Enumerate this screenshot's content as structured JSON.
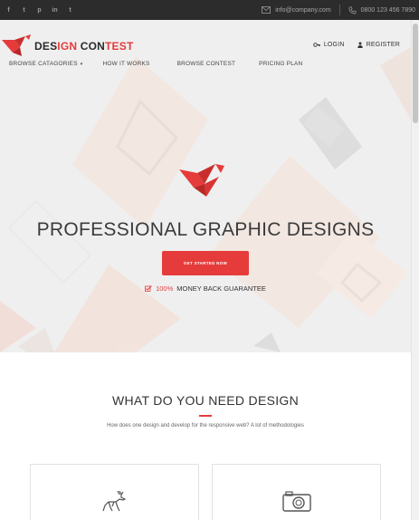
{
  "topbar": {
    "social": [
      "f",
      "t",
      "p",
      "in",
      "t"
    ],
    "email": "info@company.com",
    "phone": "0800 123 456 7890"
  },
  "header": {
    "logo": {
      "part1": "DES",
      "part2": "IGN",
      "part3": " CON",
      "part4": "TEST"
    },
    "account": {
      "login": "LOGIN",
      "register": "REGISTER"
    },
    "nav": [
      "BROWSE CATAGORIES",
      "HOW IT WORKS",
      "BROWSE CONTEST",
      "PRICING PLAN"
    ]
  },
  "hero": {
    "title": "PROFESSIONAL GRAPHIC DESIGNS",
    "cta": "GET STARTED NOW",
    "guarantee_pct": "100%",
    "guarantee_text": "MONEY BACK GUARANTEE"
  },
  "section": {
    "title": "WHAT DO YOU NEED DESIGN",
    "subtitle": "How does one design and develop for the responsive web? A lot of methodologies"
  },
  "colors": {
    "accent": "#e63b3b",
    "topbar": "#2c2c2c",
    "hero_bg": "#efefef"
  },
  "icons": [
    "facebook-icon",
    "twitter-icon",
    "pinterest-icon",
    "linkedin-icon",
    "tumblr-icon",
    "mail-icon",
    "phone-icon",
    "key-icon",
    "user-icon",
    "bird-logo-icon",
    "deer-icon",
    "camera-icon"
  ]
}
